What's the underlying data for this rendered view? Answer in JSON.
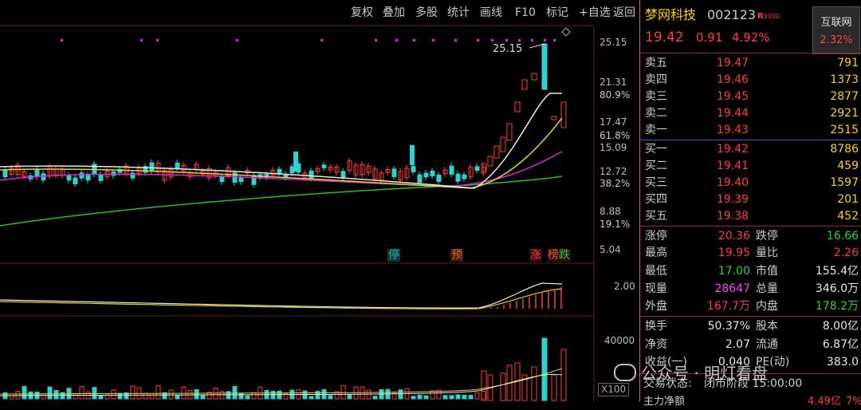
{
  "toolbar": {
    "items": [
      "复权",
      "叠加",
      "多股",
      "统计",
      "画线",
      "F10",
      "标记",
      "+自选",
      "返回"
    ]
  },
  "price_axis": {
    "prices": [
      "25.15",
      "21.31",
      "17.47",
      "15.09",
      "12.72",
      "8.88",
      "5.04"
    ],
    "percents": [
      "80.9%",
      "61.8%",
      "38.2%",
      "19.1%"
    ],
    "peak_label": "25.15"
  },
  "event_tags": [
    {
      "text": "停",
      "color": "#1fb0b0"
    },
    {
      "text": "预",
      "color": "#e0662a"
    },
    {
      "text": "涨",
      "color": "#ff3b3b"
    },
    {
      "text": "榜",
      "color": "#e0662a"
    },
    {
      "text": "跌",
      "color": "#2fd02f"
    }
  ],
  "sub_axes": {
    "macd_level": "2.00",
    "volume_level": "40000",
    "volume_unit": "X100"
  },
  "stock": {
    "name": "梦网科技",
    "code": "002123",
    "flag": "R",
    "flag_sub": "1000",
    "price": "19.42",
    "change": "0.91",
    "change_pct": "4.92%",
    "related_label": "互联网",
    "related_pct": "2.32%"
  },
  "order_book": {
    "asks": [
      {
        "label": "卖五",
        "price": "19.47",
        "vol": "791"
      },
      {
        "label": "卖四",
        "price": "19.46",
        "vol": "1373"
      },
      {
        "label": "卖三",
        "price": "19.45",
        "vol": "2877"
      },
      {
        "label": "卖二",
        "price": "19.44",
        "vol": "2921"
      },
      {
        "label": "卖一",
        "price": "19.43",
        "vol": "2515"
      }
    ],
    "bids": [
      {
        "label": "买一",
        "price": "19.42",
        "vol": "8786"
      },
      {
        "label": "买二",
        "price": "19.41",
        "vol": "459"
      },
      {
        "label": "买三",
        "price": "19.40",
        "vol": "1597"
      },
      {
        "label": "买四",
        "price": "19.39",
        "vol": "201"
      },
      {
        "label": "买五",
        "price": "19.38",
        "vol": "452"
      }
    ]
  },
  "quote_stats": [
    {
      "l1": "涨停",
      "v1": "20.36",
      "c1": "red",
      "l2": "跌停",
      "v2": "16.66",
      "c2": "grn"
    },
    {
      "l1": "最高",
      "v1": "19.95",
      "c1": "red",
      "l2": "量比",
      "v2": "2.26",
      "c2": "red"
    },
    {
      "l1": "最低",
      "v1": "17.00",
      "c1": "grn",
      "l2": "市值",
      "v2": "155.4亿",
      "c2": "wht"
    },
    {
      "l1": "现量",
      "v1": "28647",
      "c1": "mag",
      "l2": "总量",
      "v2": "346.0万",
      "c2": "wht"
    },
    {
      "l1": "外盘",
      "v1": "167.7万",
      "c1": "red",
      "l2": "内盘",
      "v2": "178.2万",
      "c2": "grn"
    },
    {
      "l1": "换手",
      "v1": "50.37%",
      "c1": "wht",
      "l2": "股本",
      "v2": "8.00亿",
      "c2": "wht"
    },
    {
      "l1": "净资",
      "v1": "2.07",
      "c1": "wht",
      "l2": "流通",
      "v2": "6.87亿",
      "c2": "wht"
    },
    {
      "l1": "收益(一)",
      "v1": "0.040",
      "c1": "wht",
      "l2": "PE(动)",
      "v2": "383.0",
      "c2": "wht"
    }
  ],
  "trade_status": {
    "label": "交易状态:",
    "value": "闭市阶段 15:00:00"
  },
  "bottom_cut": {
    "label": "主力净额",
    "value": "4.49亿",
    "pct": "7%"
  },
  "watermark": {
    "text": "公众号 · 明灯看盘"
  },
  "colors": {
    "up": "#ff3b3b",
    "down": "#2fd02f",
    "accent": "#ffd200",
    "panel_border": "#8a2a2a"
  }
}
